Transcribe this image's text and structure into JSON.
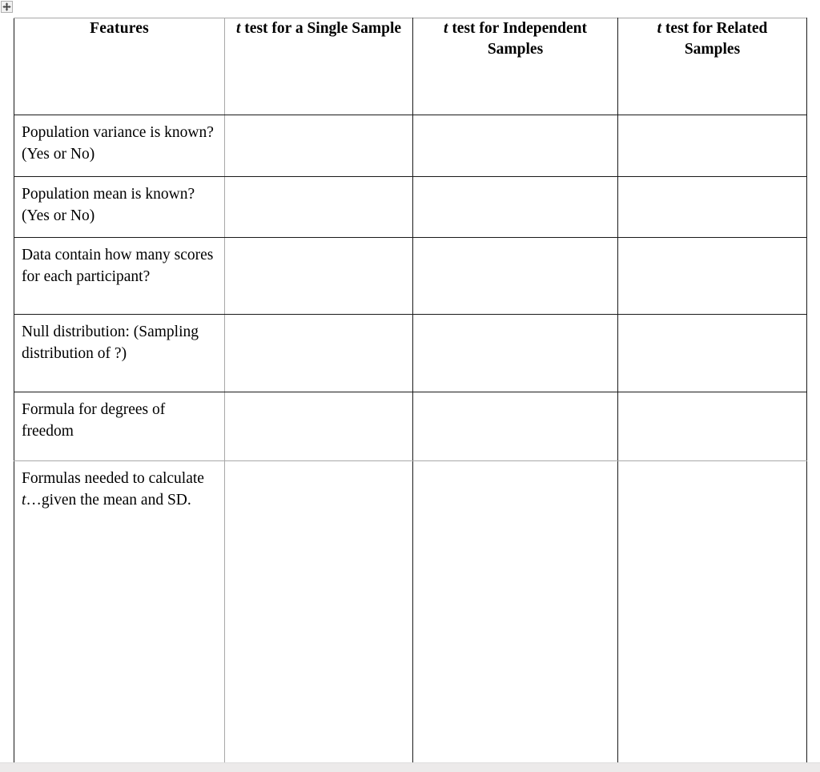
{
  "document": {
    "move_handle_icon": "table-move-handle-four-arrow-icon"
  },
  "table": {
    "columns": [
      {
        "key": "features",
        "label": "Features",
        "italic_prefix": ""
      },
      {
        "key": "single",
        "label": " test for a Single Sample",
        "italic_prefix": "t"
      },
      {
        "key": "indep",
        "label": " test for Independent Samples",
        "italic_prefix": "t"
      },
      {
        "key": "related",
        "label": " test for Related Samples",
        "italic_prefix": "t"
      }
    ],
    "header": {
      "features": "Features",
      "single_t": "t",
      "single_rest": " test for a Single Sample",
      "indep_t": "t",
      "indep_rest": " test for Independent Samples",
      "related_t": "t",
      "related_rest": " test for Related Samples"
    },
    "rows": [
      {
        "id": "population-variance-known",
        "feature": "Population variance is known? (Yes or No)",
        "single": "",
        "indep": "",
        "related": ""
      },
      {
        "id": "population-mean-known",
        "feature": "Population mean is known? (Yes or No)",
        "single": "",
        "indep": "",
        "related": ""
      },
      {
        "id": "scores-per-participant",
        "feature": "Data contain how many scores for each participant?",
        "single": "",
        "indep": "",
        "related": ""
      },
      {
        "id": "null-distribution",
        "feature": "Null distribution: (Sampling distribution of ?)",
        "single": "",
        "indep": "",
        "related": ""
      },
      {
        "id": "degrees-of-freedom",
        "feature": "Formula for degrees of freedom",
        "single": "",
        "indep": "",
        "related": ""
      },
      {
        "id": "formulas-for-t",
        "feature_part1": "Formulas needed to calculate ",
        "feature_italic": "t",
        "feature_part2": "…given the mean and SD.",
        "single": "",
        "indep": "",
        "related": ""
      }
    ]
  }
}
